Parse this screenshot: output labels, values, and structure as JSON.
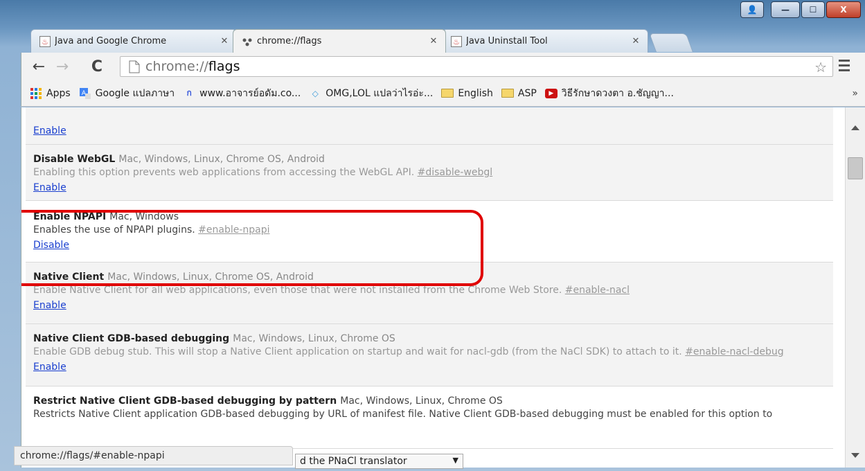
{
  "window": {
    "controls": {
      "user": "👤",
      "minimize": "—",
      "maximize": "☐",
      "close": "X"
    }
  },
  "tabs": [
    {
      "title": "Java and Google Chrome",
      "icon": "java-icon",
      "active": false
    },
    {
      "title": "chrome://flags",
      "icon": "flags-icon",
      "active": true
    },
    {
      "title": "Java Uninstall Tool",
      "icon": "java-icon",
      "active": false
    }
  ],
  "toolbar": {
    "back": "←",
    "forward": "→",
    "reload": "C",
    "url_scheme": "chrome://",
    "url_path": "flags",
    "star": "☆"
  },
  "bookmarks": [
    {
      "label": "Apps",
      "icon": "apps-grid-icon"
    },
    {
      "label": "Google แปลภาษา",
      "icon": "translate-icon"
    },
    {
      "label": "www.อาจารย์อดัม.co...",
      "icon": "site-icon"
    },
    {
      "label": "OMG,LOL แปลว่าไรอ่ะ...",
      "icon": "bookmark-icon"
    },
    {
      "label": "English",
      "icon": "folder-icon"
    },
    {
      "label": "ASP",
      "icon": "folder-icon"
    },
    {
      "label": "วิธีรักษาดวงตา อ.ชัญญา...",
      "icon": "youtube-icon"
    }
  ],
  "bookmarks_more": "»",
  "flags": [
    {
      "name": "",
      "platforms": "",
      "description": "",
      "anchor": "",
      "action": "Enable"
    },
    {
      "name": "Disable WebGL",
      "platforms": "Mac, Windows, Linux, Chrome OS, Android",
      "description": "Enabling this option prevents web applications from accessing the WebGL API.",
      "anchor": "#disable-webgl",
      "action": "Enable"
    },
    {
      "name": "Enable NPAPI",
      "platforms": "Mac, Windows",
      "description": "Enables the use of NPAPI plugins.",
      "anchor": "#enable-npapi",
      "action": "Disable"
    },
    {
      "name": "Native Client",
      "platforms": "Mac, Windows, Linux, Chrome OS, Android",
      "description": "Enable Native Client for all web applications, even those that were not installed from the Chrome Web Store.",
      "anchor": "#enable-nacl",
      "action": "Enable"
    },
    {
      "name": "Native Client GDB-based debugging",
      "platforms": "Mac, Windows, Linux, Chrome OS",
      "description": "Enable GDB debug stub. This will stop a Native Client application on startup and wait for nacl-gdb (from the NaCl SDK) to attach to it.",
      "anchor": "#enable-nacl-debug",
      "action": "Enable"
    },
    {
      "name": "Restrict Native Client GDB-based debugging by pattern",
      "platforms": "Mac, Windows, Linux, Chrome OS",
      "description": "Restricts Native Client application GDB-based debugging by URL of manifest file. Native Client GDB-based debugging must be enabled for this option to",
      "anchor": "",
      "action": ""
    }
  ],
  "pnacl_select": "d the PNaCl translator",
  "status_url": "chrome://flags/#enable-npapi"
}
